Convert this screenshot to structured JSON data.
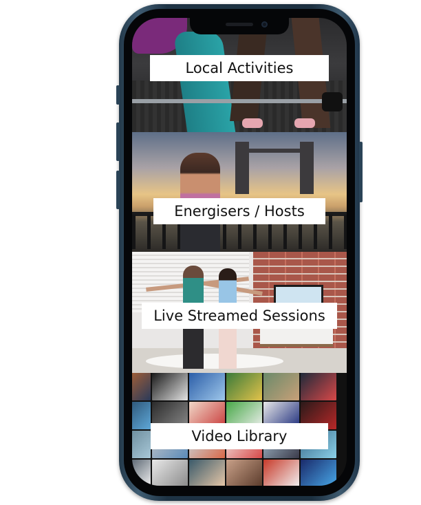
{
  "tiles": [
    {
      "label": "Local Activities"
    },
    {
      "label": "Energisers / Hosts"
    },
    {
      "label": "Live Streamed Sessions"
    },
    {
      "label": "Video Library"
    }
  ],
  "colors": {
    "phone_frame": "#1f3546",
    "label_background": "#ffffff",
    "label_text": "#111111"
  },
  "icons": {
    "camera": "front-camera-icon"
  }
}
